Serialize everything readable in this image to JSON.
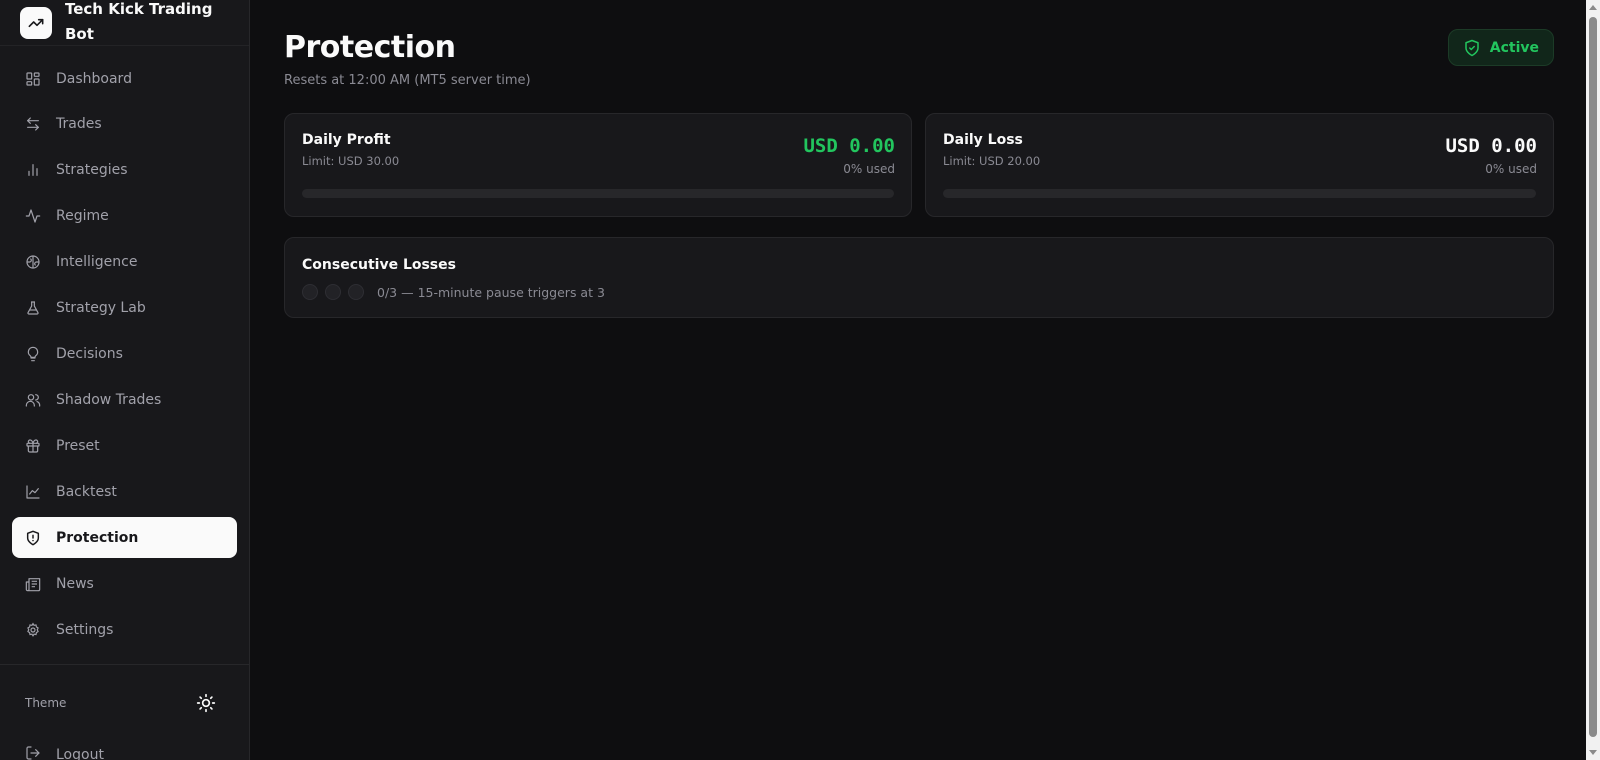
{
  "app": {
    "title": "Tech Kick Trading Bot",
    "logo_icon": "trending-up-icon"
  },
  "sidebar": {
    "items": [
      {
        "label": "Dashboard",
        "icon": "dashboard-icon",
        "active": false
      },
      {
        "label": "Trades",
        "icon": "arrows-left-right-icon",
        "active": false
      },
      {
        "label": "Strategies",
        "icon": "bar-chart-icon",
        "active": false
      },
      {
        "label": "Regime",
        "icon": "activity-icon",
        "active": false
      },
      {
        "label": "Intelligence",
        "icon": "brain-icon",
        "active": false
      },
      {
        "label": "Strategy Lab",
        "icon": "flask-icon",
        "active": false
      },
      {
        "label": "Decisions",
        "icon": "lightbulb-icon",
        "active": false
      },
      {
        "label": "Shadow Trades",
        "icon": "users-icon",
        "active": false
      },
      {
        "label": "Preset",
        "icon": "gift-icon",
        "active": false
      },
      {
        "label": "Backtest",
        "icon": "line-chart-icon",
        "active": false
      },
      {
        "label": "Protection",
        "icon": "shield-alert-icon",
        "active": true
      },
      {
        "label": "News",
        "icon": "newspaper-icon",
        "active": false
      },
      {
        "label": "Settings",
        "icon": "gear-icon",
        "active": false
      }
    ],
    "theme_label": "Theme",
    "theme_icon": "sun-icon",
    "logout_label": "Logout",
    "logout_icon": "logout-icon"
  },
  "page": {
    "title": "Protection",
    "subtitle": "Resets at 12:00 AM (MT5 server time)",
    "status": "Active",
    "status_icon": "shield-check-icon"
  },
  "cards": {
    "daily_profit": {
      "title": "Daily Profit",
      "limit": "Limit: USD 30.00",
      "value": "USD 0.00",
      "used": "0% used",
      "progress": 0,
      "value_color": "#22c55e"
    },
    "daily_loss": {
      "title": "Daily Loss",
      "limit": "Limit: USD 20.00",
      "value": "USD 0.00",
      "used": "0% used",
      "progress": 0,
      "value_color": "#fafafa"
    },
    "consecutive_losses": {
      "title": "Consecutive Losses",
      "count": 0,
      "max": 3,
      "text": "0/3 — 15-minute pause triggers at 3"
    }
  },
  "colors": {
    "background": "#0e0e10",
    "sidebar": "#18181b",
    "accent_green": "#22c55e"
  }
}
